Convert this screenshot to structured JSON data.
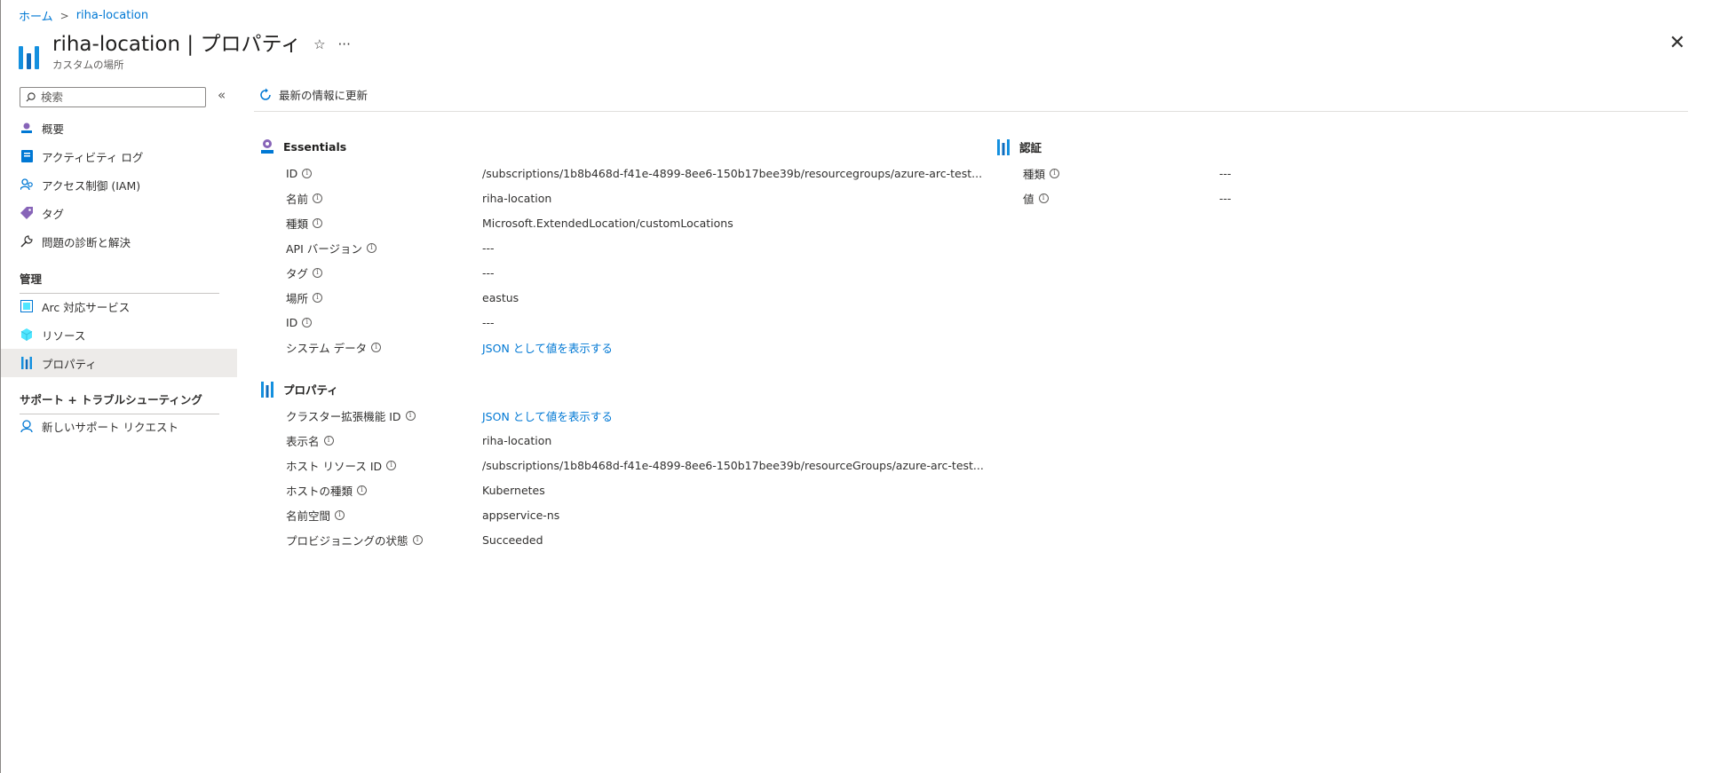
{
  "breadcrumb": {
    "home": "ホーム",
    "separator": ">",
    "current": "riha-location"
  },
  "header": {
    "title": "riha-location | プロパティ",
    "subtitle": "カスタムの場所",
    "favorite_icon": "☆",
    "more_icon": "···",
    "close_icon": "✕"
  },
  "sidebar": {
    "search_placeholder": "検索",
    "collapse_icon": "«",
    "items": [
      {
        "label": "概要",
        "icon": "overview-icon"
      },
      {
        "label": "アクティビティ ログ",
        "icon": "activity-log-icon"
      },
      {
        "label": "アクセス制御 (IAM)",
        "icon": "iam-icon"
      },
      {
        "label": "タグ",
        "icon": "tag-icon"
      },
      {
        "label": "問題の診断と解決",
        "icon": "wrench-icon"
      }
    ],
    "section_manage": "管理",
    "manage_items": [
      {
        "label": "Arc 対応サービス",
        "icon": "arc-services-icon"
      },
      {
        "label": "リソース",
        "icon": "cube-icon"
      },
      {
        "label": "プロパティ",
        "icon": "properties-icon"
      }
    ],
    "section_support": "サポート + トラブルシューティング",
    "support_items": [
      {
        "label": "新しいサポート リクエスト",
        "icon": "support-request-icon"
      }
    ]
  },
  "toolbar": {
    "refresh_label": "最新の情報に更新"
  },
  "essentials": {
    "title": "Essentials",
    "rows": [
      {
        "label": "ID",
        "value": "/subscriptions/1b8b468d-f41e-4899-8ee6-150b17bee39b/resourcegroups/azure-arc-test...",
        "link": false
      },
      {
        "label": "名前",
        "value": "riha-location",
        "link": false
      },
      {
        "label": "種類",
        "value": "Microsoft.ExtendedLocation/customLocations",
        "link": false
      },
      {
        "label": "API バージョン",
        "value": "---",
        "link": false
      },
      {
        "label": "タグ",
        "value": "---",
        "link": false
      },
      {
        "label": "場所",
        "value": "eastus",
        "link": false
      },
      {
        "label": "ID",
        "value": "---",
        "link": false
      },
      {
        "label": "システム データ",
        "value": "JSON として値を表示する",
        "link": true
      }
    ]
  },
  "auth": {
    "title": "認証",
    "rows": [
      {
        "label": "種類",
        "value": "---"
      },
      {
        "label": "値",
        "value": "---"
      }
    ]
  },
  "properties": {
    "title": "プロパティ",
    "rows": [
      {
        "label": "クラスター拡張機能 ID",
        "value": "JSON として値を表示する",
        "link": true
      },
      {
        "label": "表示名",
        "value": "riha-location",
        "link": false
      },
      {
        "label": "ホスト リソース ID",
        "value": "/subscriptions/1b8b468d-f41e-4899-8ee6-150b17bee39b/resourceGroups/azure-arc-test...",
        "link": false
      },
      {
        "label": "ホストの種類",
        "value": "Kubernetes",
        "link": false
      },
      {
        "label": "名前空間",
        "value": "appservice-ns",
        "link": false
      },
      {
        "label": "プロビジョニングの状態",
        "value": "Succeeded",
        "link": false
      }
    ]
  },
  "info_icon": "i",
  "colors": {
    "accent": "#0078d4",
    "selected_bg": "#edebe9"
  }
}
